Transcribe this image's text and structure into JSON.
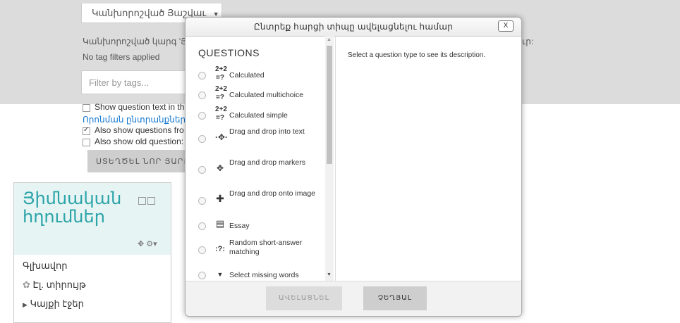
{
  "background": {
    "category_select": "Կանխորոշված Յաշվաւ",
    "category_note": "Կանխորոշված կարգ 'Յա",
    "tag_status": "No tag filters applied",
    "tag_placeholder": "Filter by tags...",
    "right_fragment": "ւր:",
    "options": {
      "show_text": "Show question text in th",
      "search_link": "Որոնման ընտրանքներ ▾",
      "also_show_from": "Also show questions fro",
      "also_show_old": "Also show old question:"
    },
    "create_button": "ՍՏԵՂԾԵԼ ՆՈՐ ՅԱՐՑ ."
  },
  "block": {
    "title": "Յիմնական հղումներ",
    "items": [
      "Գլխավոր",
      "Էլ. տիրույթ",
      "Կայքի էջեր"
    ]
  },
  "modal": {
    "title": "Ընտրեք հարցի տիպը ավելացնելու համար",
    "close_label": "X",
    "heading": "QUESTIONS",
    "description": "Select a question type to see its description.",
    "add_button": "ԱՎԵԼԱՑՆԵԼ",
    "cancel_button": "ՉԵՂՅԱԼ",
    "questions": [
      {
        "label": "Calculated",
        "icon": "2+2\n=?"
      },
      {
        "label": "Calculated multichoice",
        "icon": "2+2\n=?"
      },
      {
        "label": "Calculated simple",
        "icon": "2+2\n=?"
      },
      {
        "label": "Drag and drop into text",
        "icon": "·✥·"
      },
      {
        "label": "Drag and drop markers",
        "icon": "✥"
      },
      {
        "label": "Drag and drop onto image",
        "icon": "✚"
      },
      {
        "label": "Essay",
        "icon": "▤"
      },
      {
        "label": "Random short-answer matching",
        "icon": ":?:"
      },
      {
        "label": "Select missing words",
        "icon": "▼"
      }
    ]
  }
}
